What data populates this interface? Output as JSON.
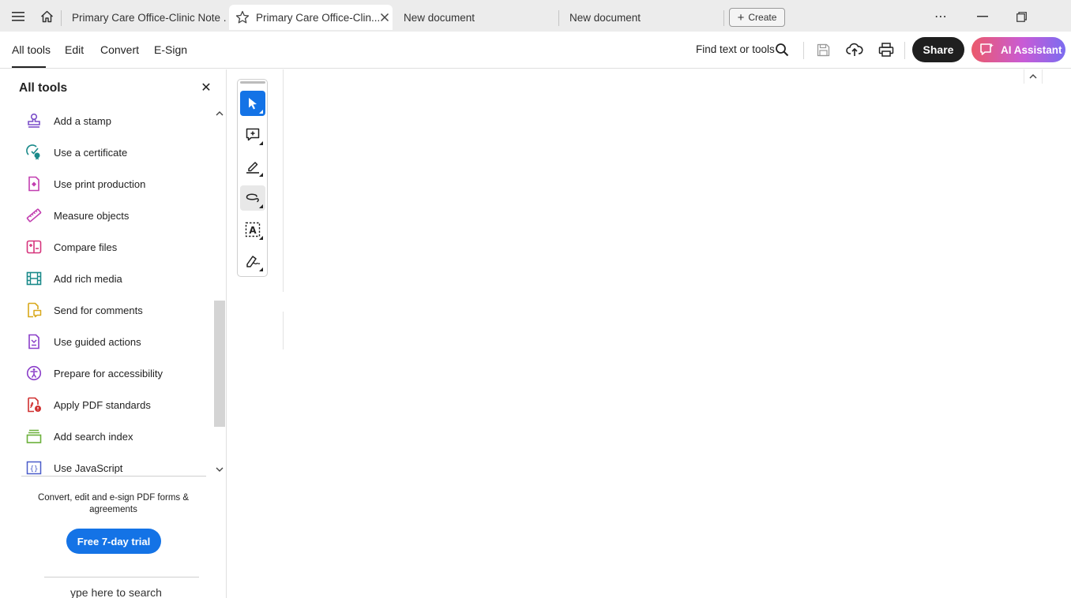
{
  "tabs": [
    {
      "label": "Primary Care Office-Clinic Note ..."
    },
    {
      "label": "Primary Care Office-Clin..."
    },
    {
      "label": "New document"
    },
    {
      "label": "New document"
    }
  ],
  "create_label": "Create",
  "menu": {
    "items": [
      "All tools",
      "Edit",
      "Convert",
      "E-Sign"
    ],
    "find_label": "Find text or tools",
    "share_label": "Share",
    "ai_label": "AI Assistant"
  },
  "panel": {
    "title": "All tools",
    "tools": [
      {
        "label": "Add a stamp",
        "icon": "stamp-icon",
        "color": "#7b4fc9"
      },
      {
        "label": "Use a certificate",
        "icon": "certificate-icon",
        "color": "#1a8a8a"
      },
      {
        "label": "Use print production",
        "icon": "print-production-icon",
        "color": "#c23fb0"
      },
      {
        "label": "Measure objects",
        "icon": "ruler-icon",
        "color": "#c23fb0"
      },
      {
        "label": "Compare files",
        "icon": "compare-icon",
        "color": "#d6347c"
      },
      {
        "label": "Add rich media",
        "icon": "film-icon",
        "color": "#1a8a8a"
      },
      {
        "label": "Send for comments",
        "icon": "send-comments-icon",
        "color": "#d8a81a"
      },
      {
        "label": "Use guided actions",
        "icon": "guided-actions-icon",
        "color": "#8b3fc9"
      },
      {
        "label": "Prepare for accessibility",
        "icon": "accessibility-icon",
        "color": "#8b3fc9"
      },
      {
        "label": "Apply PDF standards",
        "icon": "pdf-standards-icon",
        "color": "#d03030"
      },
      {
        "label": "Add search index",
        "icon": "search-index-icon",
        "color": "#6bb03a"
      },
      {
        "label": "Use JavaScript",
        "icon": "javascript-icon",
        "color": "#4a5cc9"
      }
    ],
    "promo_text": "Convert, edit and e-sign PDF forms & agreements",
    "trial_label": "Free 7-day trial",
    "search_hint": "ype here to search"
  },
  "colors": {
    "accent": "#1473e6",
    "share_bg": "#1f1f1f"
  }
}
